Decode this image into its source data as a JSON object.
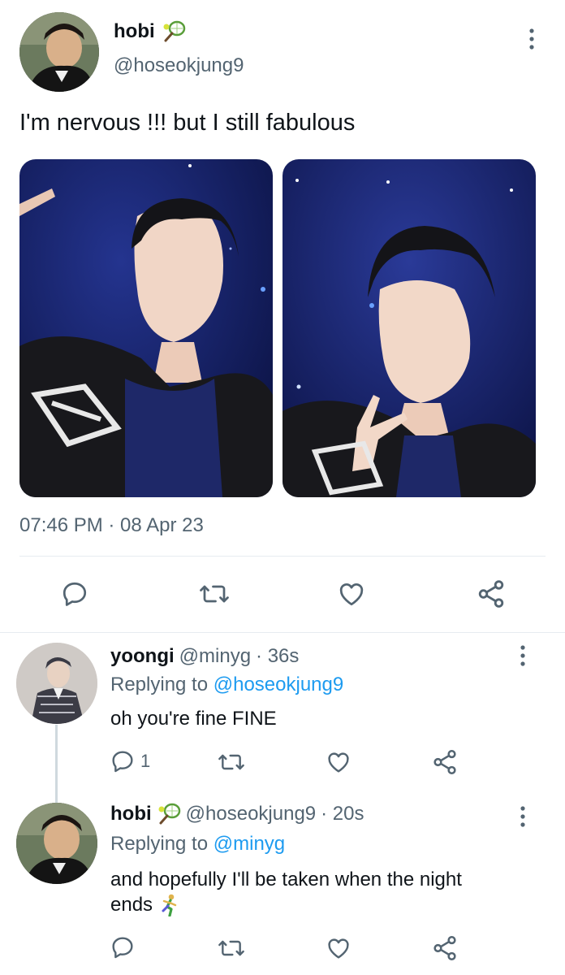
{
  "main_tweet": {
    "display_name": "hobi",
    "name_emoji": "tennis-racket-icon",
    "handle": "@hoseokjung9",
    "text": "I'm nervous !!! but I still fabulous",
    "timestamp": "07:46 PM · 08 Apr 23",
    "actions": [
      "reply-icon",
      "retweet-icon",
      "like-icon",
      "share-icon"
    ]
  },
  "replies": [
    {
      "display_name": "yoongi",
      "handle": "@minyg",
      "time": "· 36s",
      "replying_prefix": "Replying to",
      "replying_to": "@hoseokjung9",
      "text": "oh you're fine FINE",
      "reply_count": "1"
    },
    {
      "display_name": "hobi",
      "name_emoji": "tennis-racket-icon",
      "handle": "@hoseokjung9",
      "time": "· 20s",
      "replying_prefix": "Replying to",
      "replying_to": "@minyg",
      "text_line1": "and hopefully I'll be taken when the night",
      "text_line2": "ends",
      "text_emoji": "running-person-icon"
    }
  ],
  "colors": {
    "text": "#0f1419",
    "muted": "#536471",
    "link": "#1d9bf0",
    "divider": "#eff3f4"
  }
}
